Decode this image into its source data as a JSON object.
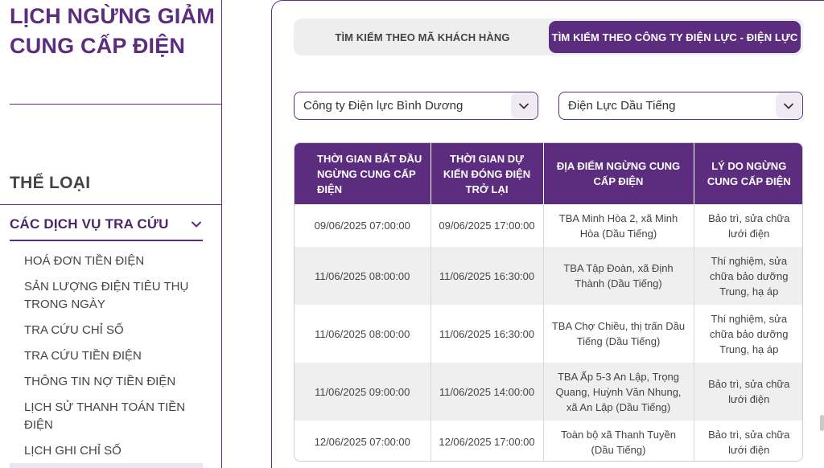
{
  "sidebar": {
    "page_title": "LỊCH NGỪNG GIẢM CUNG CẤP ĐIỆN",
    "section_heading": "THỂ LOẠI",
    "group": {
      "label": "CÁC DỊCH VỤ TRA CỨU",
      "icon": "chevron-down-icon"
    },
    "items": [
      {
        "label": "HOÁ ĐƠN TIỀN ĐIỆN"
      },
      {
        "label": "SẢN LƯỢNG ĐIỆN TIÊU THỤ TRONG NGÀY"
      },
      {
        "label": "TRA CỨU CHỈ SỐ"
      },
      {
        "label": "TRA CỨU TIỀN ĐIỆN"
      },
      {
        "label": "THÔNG TIN NỢ TIỀN ĐIỆN"
      },
      {
        "label": "LỊCH SỬ THANH TOÁN TIỀN ĐIỆN"
      },
      {
        "label": "LỊCH GHI CHỈ SỐ"
      }
    ]
  },
  "tabs": [
    {
      "label": "TÌM KIẾM THEO MÃ KHÁCH HÀNG",
      "active": false
    },
    {
      "label": "TÌM KIẾM THEO CÔNG TY ĐIỆN LỰC - ĐIỆN LỰC",
      "active": true
    }
  ],
  "filters": {
    "company": {
      "value": "Công ty Điện lực Bình Dương",
      "icon": "chevron-down-icon"
    },
    "branch": {
      "value": "Điện Lực Dầu Tiếng",
      "icon": "chevron-down-icon"
    }
  },
  "table": {
    "headers": [
      "THỜI GIAN BẮT ĐẦU NGỪNG CUNG CẤP ĐIỆN",
      "THỜI GIAN DỰ KIẾN ĐÓNG ĐIỆN TRỞ LẠI",
      "ĐỊA ĐIỂM NGỪNG CUNG CẤP ĐIỆN",
      "LÝ DO NGỪNG CUNG CẤP ĐIỆN"
    ],
    "rows": [
      {
        "start": "09/06/2025 07:00:00",
        "end": "09/06/2025 17:00:00",
        "location": "TBA Minh Hòa 2, xã Minh Hòa (Dầu Tiếng)",
        "reason": "Bảo trì, sửa chữa lưới điện"
      },
      {
        "start": "11/06/2025 08:00:00",
        "end": "11/06/2025 16:30:00",
        "location": "TBA Tập Đoàn, xã Định Thành (Dầu Tiếng)",
        "reason": "Thí nghiệm, sửa chữa bảo dưỡng Trung, hạ áp"
      },
      {
        "start": "11/06/2025 08:00:00",
        "end": "11/06/2025 16:30:00",
        "location": "TBA Chợ Chiều, thị trấn Dầu Tiếng (Dầu Tiếng)",
        "reason": "Thí nghiệm, sửa chữa bảo dưỡng Trung, hạ áp"
      },
      {
        "start": "11/06/2025 09:00:00",
        "end": "11/06/2025 14:00:00",
        "location": "TBA Ấp 5-3 An Lập, Trọng Quang, Huỳnh Văn Nhung, xã An Lập (Dầu Tiếng)",
        "reason": "Bảo trì, sửa chữa lưới điện"
      },
      {
        "start": "12/06/2025 07:00:00",
        "end": "12/06/2025 17:00:00",
        "location": "Toàn bộ xã Thanh Tuyền (Dầu Tiếng)",
        "reason": "Bảo trì, sửa chữa lưới điện"
      }
    ]
  },
  "colors": {
    "brand": "#5c2d7e",
    "row_alt": "#efefef"
  }
}
